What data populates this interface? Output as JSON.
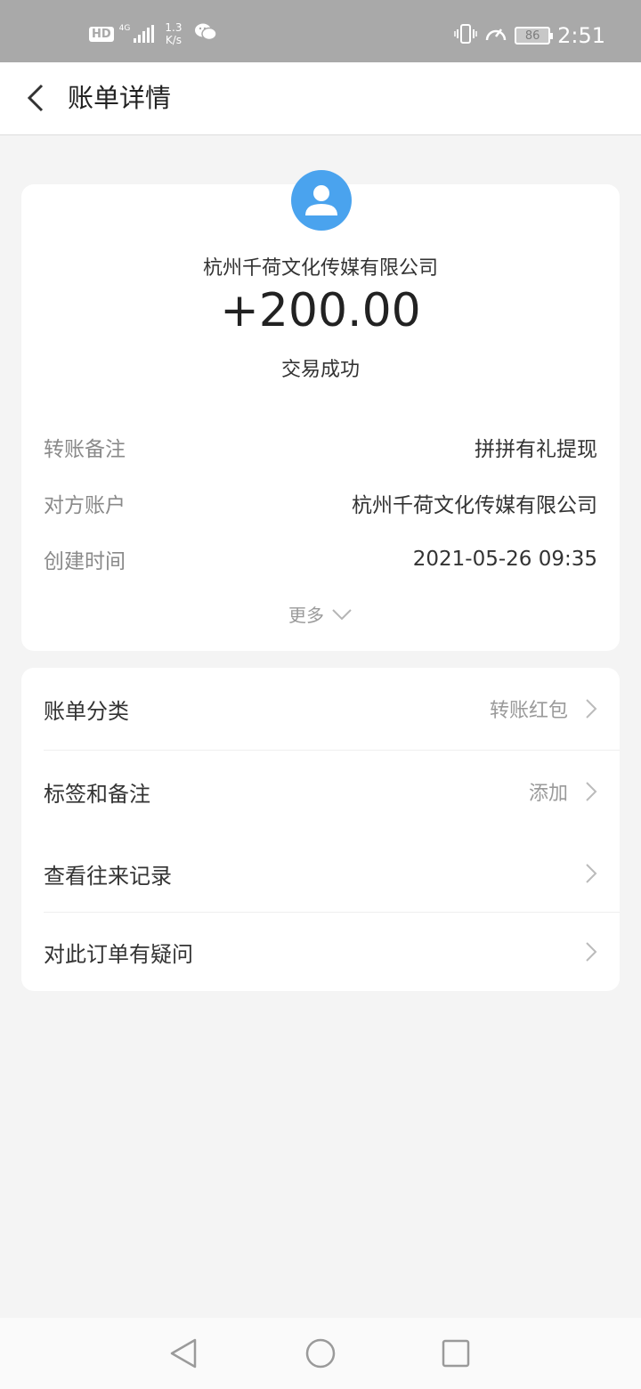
{
  "status_bar": {
    "hd": "HD",
    "network": "4G",
    "speed_value": "1.3",
    "speed_unit": "K/s",
    "battery": "86",
    "time": "2:51"
  },
  "header": {
    "title": "账单详情"
  },
  "transaction": {
    "payer": "杭州千荷文化传媒有限公司",
    "amount": "+200.00",
    "status": "交易成功",
    "details": [
      {
        "label": "转账备注",
        "value": "拼拼有礼提现"
      },
      {
        "label": "对方账户",
        "value": "杭州千荷文化传媒有限公司"
      },
      {
        "label": "创建时间",
        "value": "2021-05-26 09:35"
      }
    ],
    "more": "更多"
  },
  "menu": {
    "items": [
      {
        "label": "账单分类",
        "value": "转账红包"
      },
      {
        "label": "标签和备注",
        "value": "添加"
      },
      {
        "label": "查看往来记录",
        "value": ""
      },
      {
        "label": "对此订单有疑问",
        "value": ""
      }
    ]
  },
  "colors": {
    "accent": "#4aa3ee",
    "status_bar": "#a9a9a9",
    "background": "#f4f4f4"
  }
}
